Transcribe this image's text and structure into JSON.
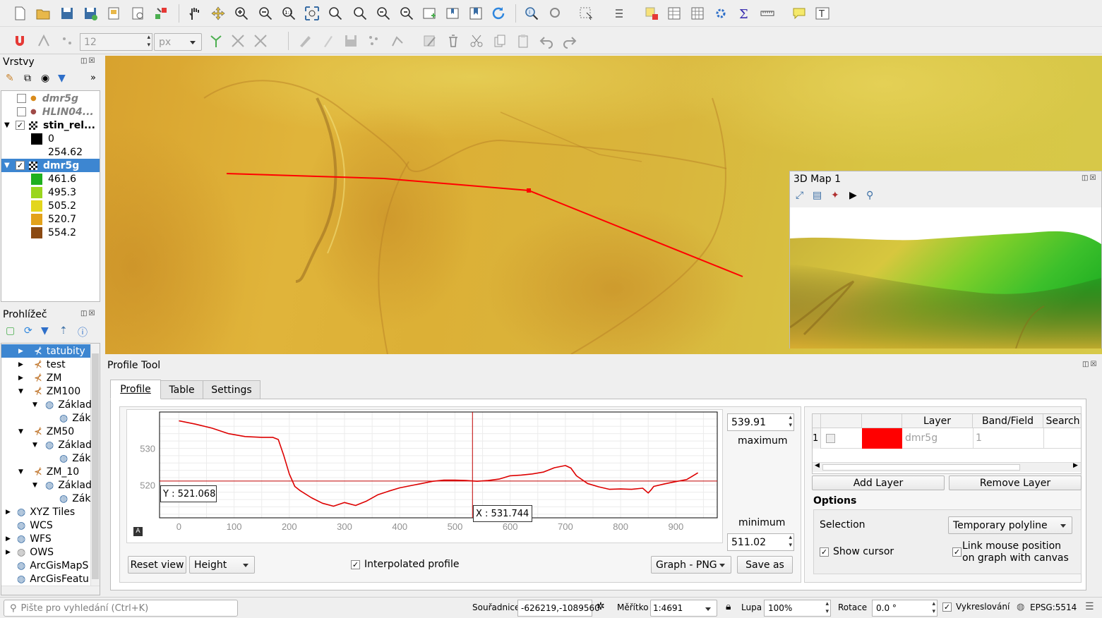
{
  "layers_panel": {
    "title": "Vrstvy",
    "items": [
      {
        "label": "dmr5g",
        "checked": false
      },
      {
        "label": "HLIN04...",
        "checked": false
      },
      {
        "label": "stin_rel...",
        "checked": true
      },
      {
        "label": "0"
      },
      {
        "label": "254.62"
      },
      {
        "label": "dmr5g",
        "checked": true
      },
      {
        "label": "461.6",
        "color": "#1fb01f"
      },
      {
        "label": "495.3",
        "color": "#9ad61e"
      },
      {
        "label": "505.2",
        "color": "#e3d61c"
      },
      {
        "label": "520.7",
        "color": "#e3a21a"
      },
      {
        "label": "554.2",
        "color": "#8b4a12"
      }
    ]
  },
  "browser_panel": {
    "title": "Prohlížeč",
    "items": [
      {
        "label": "tatubity"
      },
      {
        "label": "test"
      },
      {
        "label": "ZM"
      },
      {
        "label": "ZM100"
      },
      {
        "label": "Základ"
      },
      {
        "label": "Zák"
      },
      {
        "label": "ZM50"
      },
      {
        "label": "Základ"
      },
      {
        "label": "Zák"
      },
      {
        "label": "ZM_10"
      },
      {
        "label": "Základ"
      },
      {
        "label": "Zák"
      },
      {
        "label": "XYZ Tiles"
      },
      {
        "label": "WCS"
      },
      {
        "label": "WFS"
      },
      {
        "label": "OWS"
      },
      {
        "label": "ArcGisMapS"
      },
      {
        "label": "ArcGisFeatu"
      }
    ]
  },
  "toolbar2": {
    "size_value": "12",
    "unit_value": "px"
  },
  "map3d": {
    "title": "3D Map 1"
  },
  "profile_tool": {
    "title": "Profile Tool",
    "tabs": [
      "Profile",
      "Table",
      "Settings"
    ],
    "max_value": "539.91",
    "max_label": "maximum",
    "min_label": "minimum",
    "min_value": "511.02",
    "y_readout": "Y : 521.068",
    "x_readout": "X : 531.744",
    "reset_view": "Reset view",
    "height_option": "Height",
    "interpolated_label": "Interpolated profile",
    "graph_format": "Graph - PNG",
    "save_as": "Save as",
    "table": {
      "headers": [
        "Layer",
        "Band/Field",
        "Search"
      ],
      "row": {
        "index": "1",
        "color": "#ff0000",
        "layer": "dmr5g",
        "band": "1"
      }
    },
    "add_layer": "Add Layer",
    "remove_layer": "Remove Layer",
    "options_title": "Options",
    "selection_label": "Selection",
    "selection_value": "Temporary polyline",
    "show_cursor": "Show cursor",
    "link_mouse_1": "Link mouse position",
    "link_mouse_2": "on graph with canvas"
  },
  "chart_data": {
    "type": "line",
    "x": [
      0,
      30,
      60,
      90,
      120,
      150,
      170,
      180,
      190,
      200,
      210,
      220,
      240,
      260,
      280,
      300,
      320,
      340,
      360,
      380,
      400,
      420,
      440,
      460,
      480,
      500,
      520,
      540,
      560,
      580,
      600,
      620,
      640,
      660,
      680,
      700,
      710,
      720,
      740,
      760,
      780,
      800,
      820,
      840,
      850,
      855,
      860,
      880,
      900,
      920,
      930,
      940
    ],
    "y": [
      537.5,
      536.6,
      535.5,
      534,
      533.2,
      533,
      533,
      532.4,
      528,
      523,
      519.6,
      518.4,
      516.5,
      515,
      514.2,
      515.2,
      514.4,
      515.6,
      517.3,
      518.3,
      519.2,
      519.8,
      520.4,
      521,
      521.3,
      521.3,
      521.2,
      521,
      521.2,
      521.6,
      522.5,
      522.7,
      523,
      523.5,
      524.7,
      525.3,
      524.6,
      522.5,
      520.4,
      519.5,
      518.8,
      518.9,
      518.8,
      519.1,
      517.8,
      518.6,
      519.6,
      520.3,
      520.9,
      521.5,
      522.4,
      523.3
    ],
    "xlim": [
      -35,
      975
    ],
    "ylim": [
      511.02,
      539.91
    ],
    "x_ticks": [
      0,
      100,
      200,
      300,
      400,
      500,
      600,
      700,
      800,
      900
    ],
    "y_ticks": [
      530,
      520
    ],
    "cursor": {
      "x": 531.744,
      "y": 521.068
    },
    "color": "#dd0000"
  },
  "search": {
    "placeholder": "Pište pro vyhledání (Ctrl+K)"
  },
  "statusbar": {
    "coord_label": "Souřadnice",
    "coord_value": "-626219,-1089560",
    "scale_label": "Měřítko",
    "scale_value": "1:4691",
    "magnifier_label": "Lupa",
    "magnifier_value": "100%",
    "rotation_label": "Rotace",
    "rotation_value": "0.0 °",
    "render_label": "Vykreslování",
    "crs": "EPSG:5514"
  }
}
